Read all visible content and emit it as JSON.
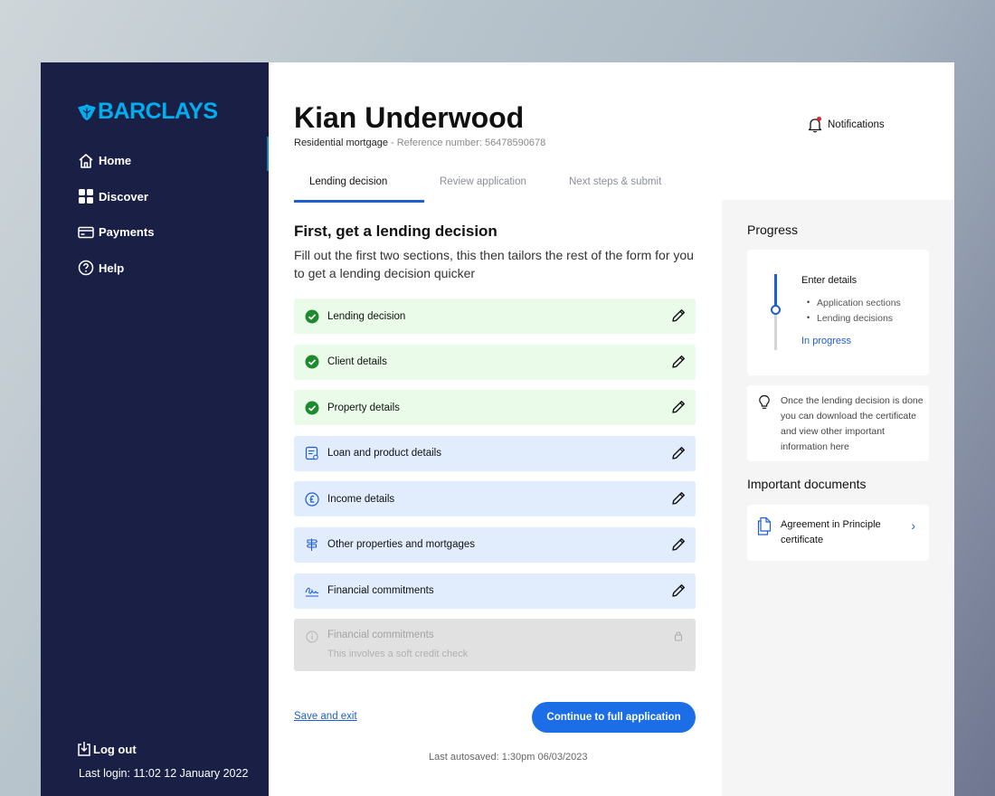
{
  "brand": {
    "name": "BARCLAYS"
  },
  "sidebar": {
    "items": [
      {
        "label": "Home",
        "icon": "home-icon"
      },
      {
        "label": "Discover",
        "icon": "grid-icon"
      },
      {
        "label": "Payments",
        "icon": "card-icon"
      },
      {
        "label": "Help",
        "icon": "help-icon"
      }
    ],
    "logout_label": "Log out",
    "last_login": "Last login: 11:02 12 January 2022"
  },
  "header": {
    "client_name": "Kian Underwood",
    "product": "Residential mortgage",
    "reference": " - Reference number: 56478590678",
    "notifications_label": "Notifications"
  },
  "tabs": [
    {
      "label": "Lending decision",
      "active": true
    },
    {
      "label": "Review application",
      "active": false
    },
    {
      "label": "Next steps & submit",
      "active": false
    }
  ],
  "main": {
    "title": "First, get a lending decision",
    "description": "Fill out the first two sections, this then tailors the rest of the form for you to get a lending decision quicker",
    "sections": [
      {
        "label": "Lending decision",
        "status": "done",
        "icon": "check-circle-icon"
      },
      {
        "label": "Client details",
        "status": "done",
        "icon": "check-circle-icon"
      },
      {
        "label": "Property details",
        "status": "done",
        "icon": "check-circle-icon"
      },
      {
        "label": "Loan and product details",
        "status": "todo",
        "icon": "document-icon"
      },
      {
        "label": "Income details",
        "status": "todo",
        "icon": "pound-icon"
      },
      {
        "label": "Other properties and mortgages",
        "status": "todo",
        "icon": "signpost-icon"
      },
      {
        "label": "Financial commitments",
        "status": "todo",
        "icon": "signature-icon"
      }
    ],
    "locked_section": {
      "label": "Financial commitments",
      "sub": "This involves a soft credit check"
    },
    "save_exit_label": "Save and exit",
    "continue_label": "Continue to full application",
    "autosave": "Last autosaved: 1:30pm 06/03/2023"
  },
  "progress": {
    "title": "Progress",
    "step": "Enter details",
    "items": [
      "Application sections",
      "Lending decisions"
    ],
    "status": "In progress",
    "tip": "Once the lending decision is done you can download the certificate and view other important information here"
  },
  "documents": {
    "title": "Important documents",
    "item": "Agreement in Principle certificate"
  },
  "colors": {
    "sidebar_bg": "#1a1f45",
    "accent": "#1b6ee6",
    "done_bg": "#eafbea",
    "todo_bg": "#e1ecfc",
    "success": "#1e8a2e",
    "brand": "#00aeef"
  }
}
